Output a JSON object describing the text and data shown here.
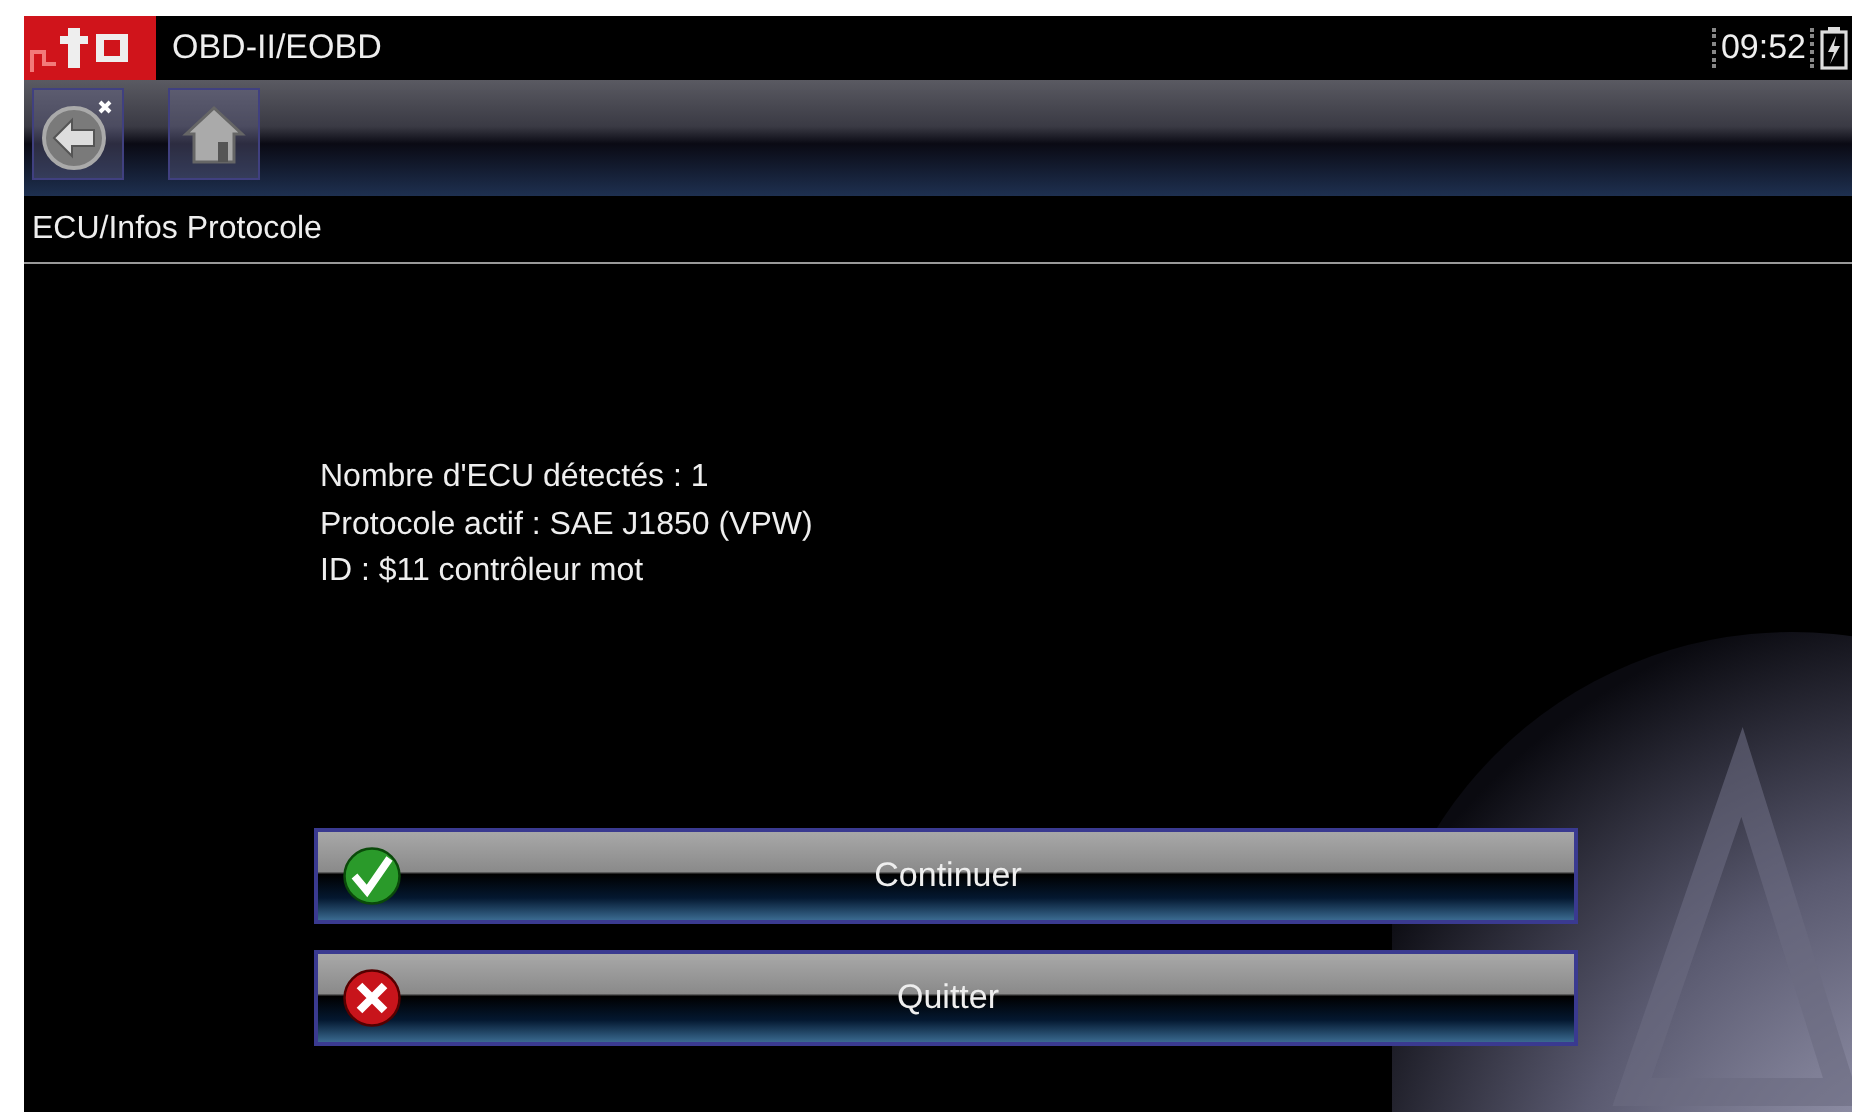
{
  "title_bar": {
    "title": "OBD-II/EOBD",
    "time": "09:52"
  },
  "toolbar": {
    "buttons": [
      {
        "kind": "back"
      },
      {
        "kind": "home"
      }
    ]
  },
  "section": {
    "title": "ECU/Infos Protocole"
  },
  "info_lines": [
    "Nombre d'ECU détectés : 1",
    "Protocole actif : SAE J1850 (VPW)",
    "ID : $11 contrôleur mot"
  ],
  "actions": [
    {
      "label": "Continuer",
      "kind": "confirm"
    },
    {
      "label": "Quitter",
      "kind": "cancel"
    }
  ]
}
